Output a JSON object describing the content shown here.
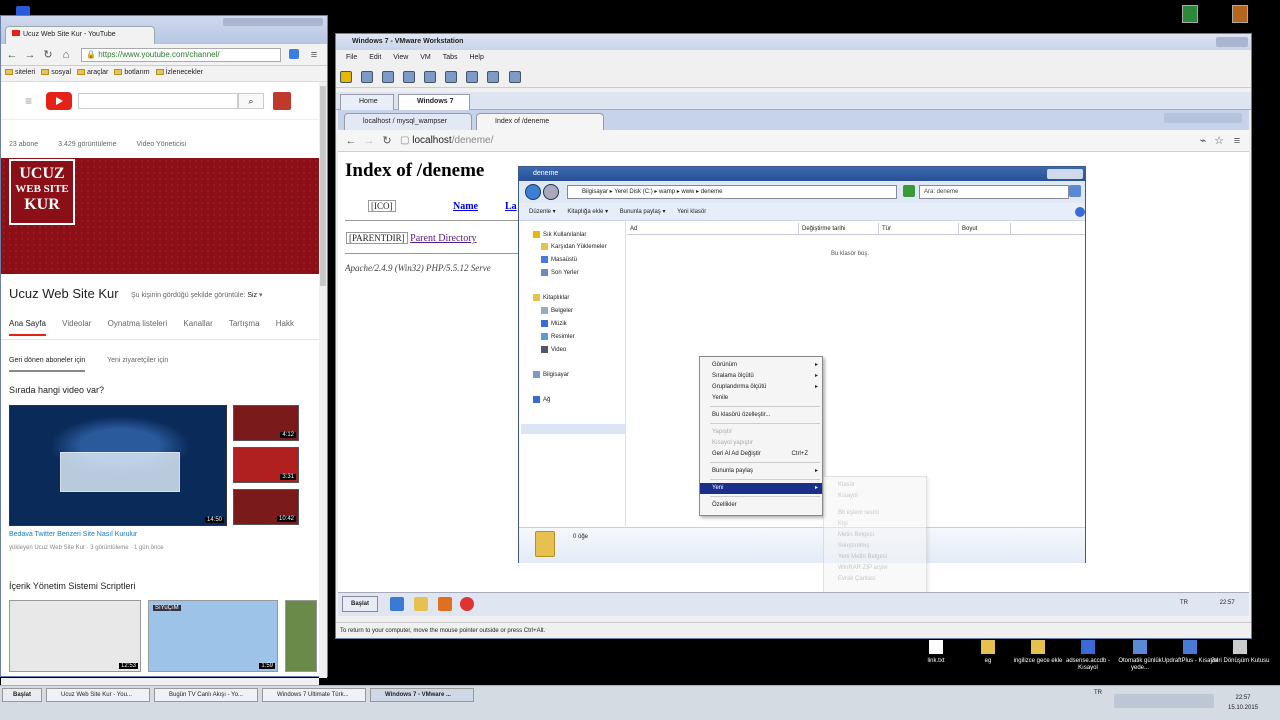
{
  "left_browser": {
    "tab_title": "Ucuz Web Site Kur - YouTube",
    "url": "https://www.youtube.com/channel/",
    "bookmarks": [
      "siteleri",
      "sosyal",
      "araçlar",
      "botlarım",
      "İzlenecekler"
    ],
    "stats": [
      "23 abone",
      "3.429 görüntüleme",
      "Video Yöneticisi"
    ],
    "banner_logo_lines": [
      "UCUZ",
      "WEB SITE",
      "KUR"
    ],
    "channel_name": "Ucuz Web Site Kur",
    "channel_sub": "Şu kişinin gördüğü şekilde görüntüle:",
    "channel_sub_value": "Siz",
    "tabs": [
      "Ana Sayfa",
      "Videolar",
      "Oynatma listeleri",
      "Kanallar",
      "Tartışma",
      "Hakk"
    ],
    "subtabs": [
      "Geri dönen aboneler için",
      "Yeni ziyaretçiler için"
    ],
    "section1_title": "Sırada hangi video var?",
    "main_video_duration": "14:50",
    "main_video_title": "Bedava Twitter Benzeri Site Nasıl Kurulur",
    "main_video_meta": "yükleyen Ucuz Web Site Kur · 3 görüntüleme · 1 gün önce",
    "side_durations": [
      "4:12",
      "3:31",
      "10:42"
    ],
    "section2_title": "İçerik Yönetim Sistemi Scriptleri",
    "bottom_durations": [
      "12:53",
      "1:59"
    ],
    "bottom_badge": "SıYuÇıM"
  },
  "vmware": {
    "title": "Windows 7 - VMware Workstation",
    "menu": [
      "File",
      "Edit",
      "View",
      "VM",
      "Tabs",
      "Help"
    ],
    "tabs": [
      "Home",
      "Windows 7"
    ],
    "status": "To return to your computer, move the mouse pointer outside or press Ctrl+Alt."
  },
  "guest_browser": {
    "tabs": [
      "localhost / mysql_wampser",
      "Index of /deneme"
    ],
    "url_host": "localhost",
    "url_path": "/deneme/",
    "h1": "Index of /deneme",
    "ico_alt": "[ICO]",
    "name_link": "Name",
    "la_link": "La",
    "parentdir_alt": "[PARENTDIR]",
    "parent_link": "Parent Directory",
    "address": "Apache/2.4.9 (Win32) PHP/5.5.12 Serve"
  },
  "explorer": {
    "title": "deneme",
    "path": "Bilgisayar ▸ Yerel Disk (C:) ▸ wamp ▸ www ▸ deneme",
    "search": "Ara: deneme",
    "commands": [
      "Düzenle ▾",
      "Kitaplığa ekle ▾",
      "Bununla paylaş ▾",
      "Yeni klasör"
    ],
    "nav": [
      "Sık Kullanılanlar",
      "Karşıdan Yüklemeler",
      "Masaüstü",
      "Son Yerler",
      "Kitaplıklar",
      "Belgeler",
      "Müzik",
      "Resimler",
      "Video",
      "Bilgisayar",
      "Ağ"
    ],
    "columns": [
      "Ad",
      "Değiştirme tarihi",
      "Tür",
      "Boyut"
    ],
    "empty_text": "Bu klasör boş.",
    "item_count": "0 öğe"
  },
  "context_menu": {
    "items": [
      {
        "label": "Görünüm",
        "arrow": true
      },
      {
        "label": "Sıralama ölçütü",
        "arrow": true
      },
      {
        "label": "Gruplandırma ölçütü",
        "arrow": true
      },
      {
        "label": "Yenile"
      },
      {
        "label": "Bu klasörü özelleştir..."
      },
      {
        "label": "Yapıştır",
        "disabled": true
      },
      {
        "label": "Kısayol yapıştır",
        "disabled": true
      },
      {
        "label": "Geri Al Ad Değiştir",
        "shortcut": "Ctrl+Z"
      },
      {
        "label": "Bununla paylaş",
        "arrow": true
      },
      {
        "label": "Yeni",
        "arrow": true,
        "highlighted": true
      },
      {
        "label": "Özellikler"
      }
    ],
    "submenu": [
      "Klasör",
      "Kısayol",
      "Bit eşlem resmi",
      "Kişi",
      "Metin Belgesi",
      "Sıkıştırılmış",
      "Yeni Metin Belgesi",
      "WinRAR ZIP arşivi",
      "Evrak Çantası"
    ]
  },
  "guest_taskbar": {
    "start": "Başlat",
    "tray": "TR",
    "clock": "22:57"
  },
  "desktop_icons": [
    "link.txt",
    "eg",
    "ingilizce gece ekle",
    "adsense.accdb - Kısayol",
    "Otomatik günlük yede...",
    "UpdraftPlus - Kısayol",
    "Geri Dönüşüm Kutusu"
  ],
  "host_taskbar": {
    "start": "Başlat",
    "tasks": [
      "Ucuz Web Site Kur - You...",
      "Bugün TV Canlı Akışı - Yo...",
      "Windows 7 Ultimate Türk...",
      "Windows 7 - VMware ..."
    ],
    "lang": "TR",
    "clock_time": "22:57",
    "clock_date": "15.10.2015"
  },
  "colors": {
    "youtube_red": "#e62117",
    "banner_red": "#8a0f16",
    "menu_highlight": "#1a2e8a"
  }
}
